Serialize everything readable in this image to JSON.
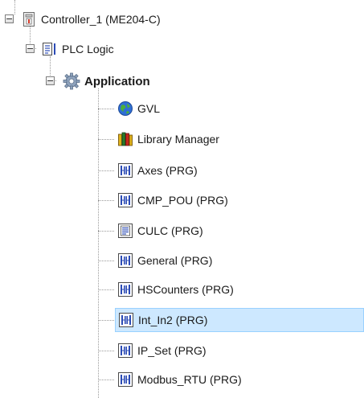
{
  "tree": {
    "controller": {
      "label": "Controller_1 (ME204-C)",
      "icon": "controller-icon"
    },
    "plc_logic": {
      "label": "PLC Logic",
      "icon": "plc-logic-icon"
    },
    "application": {
      "label": "Application",
      "icon": "gear-icon"
    },
    "children": [
      {
        "label": "GVL",
        "icon": "globe-icon"
      },
      {
        "label": "Library Manager",
        "icon": "library-books-icon"
      },
      {
        "label": "Axes (PRG)",
        "icon": "ladder-program-icon"
      },
      {
        "label": "CMP_POU (PRG)",
        "icon": "ladder-program-icon"
      },
      {
        "label": "CULC (PRG)",
        "icon": "document-program-icon"
      },
      {
        "label": "General (PRG)",
        "icon": "ladder-program-icon"
      },
      {
        "label": "HSCounters (PRG)",
        "icon": "ladder-program-icon"
      },
      {
        "label": "Int_In2 (PRG)",
        "icon": "ladder-program-icon",
        "selected": true
      },
      {
        "label": "IP_Set (PRG)",
        "icon": "ladder-program-icon"
      },
      {
        "label": "Modbus_RTU (PRG)",
        "icon": "ladder-program-icon"
      }
    ]
  },
  "colors": {
    "selection_bg": "#cde8ff",
    "selection_border": "#99d1ff",
    "ladder_icon": "#2b4bb5"
  }
}
